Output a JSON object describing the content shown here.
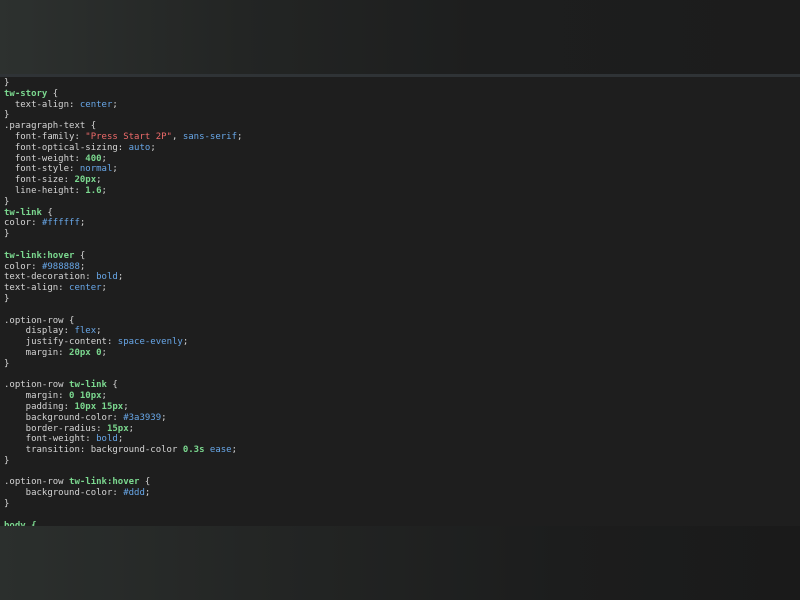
{
  "editor": {
    "lines": [
      [
        {
          "t": "}",
          "c": "punc"
        }
      ],
      [
        {
          "t": "tw-story",
          "c": "sel"
        },
        {
          "t": " {",
          "c": "punc"
        }
      ],
      [
        {
          "t": "  text-align: ",
          "c": "prop"
        },
        {
          "t": "center",
          "c": "val"
        },
        {
          "t": ";",
          "c": "punc"
        }
      ],
      [
        {
          "t": "}",
          "c": "punc"
        }
      ],
      [
        {
          "t": ".paragraph-text",
          "c": "prop"
        },
        {
          "t": " {",
          "c": "punc"
        }
      ],
      [
        {
          "t": "  font-family: ",
          "c": "prop"
        },
        {
          "t": "\"Press Start 2P\"",
          "c": "str"
        },
        {
          "t": ", ",
          "c": "punc"
        },
        {
          "t": "sans-serif",
          "c": "val"
        },
        {
          "t": ";",
          "c": "punc"
        }
      ],
      [
        {
          "t": "  font-optical-sizing: ",
          "c": "prop"
        },
        {
          "t": "auto",
          "c": "val"
        },
        {
          "t": ";",
          "c": "punc"
        }
      ],
      [
        {
          "t": "  font-weight: ",
          "c": "prop"
        },
        {
          "t": "400",
          "c": "num"
        },
        {
          "t": ";",
          "c": "punc"
        }
      ],
      [
        {
          "t": "  font-style: ",
          "c": "prop"
        },
        {
          "t": "normal",
          "c": "val"
        },
        {
          "t": ";",
          "c": "punc"
        }
      ],
      [
        {
          "t": "  font-size: ",
          "c": "prop"
        },
        {
          "t": "20px",
          "c": "num"
        },
        {
          "t": ";",
          "c": "punc"
        }
      ],
      [
        {
          "t": "  line-height: ",
          "c": "prop"
        },
        {
          "t": "1.6",
          "c": "num"
        },
        {
          "t": ";",
          "c": "punc"
        }
      ],
      [
        {
          "t": "}",
          "c": "punc"
        }
      ],
      [
        {
          "t": "tw-link",
          "c": "sel"
        },
        {
          "t": " {",
          "c": "punc"
        }
      ],
      [
        {
          "t": "color: ",
          "c": "prop"
        },
        {
          "t": "#ffffff",
          "c": "hex"
        },
        {
          "t": ";",
          "c": "punc"
        }
      ],
      [
        {
          "t": "}",
          "c": "punc"
        }
      ],
      [],
      [
        {
          "t": "tw-link:hover",
          "c": "sel"
        },
        {
          "t": " {",
          "c": "punc"
        }
      ],
      [
        {
          "t": "color: ",
          "c": "prop"
        },
        {
          "t": "#988888",
          "c": "hex"
        },
        {
          "t": ";",
          "c": "punc"
        }
      ],
      [
        {
          "t": "text-decoration: ",
          "c": "prop"
        },
        {
          "t": "bold",
          "c": "val"
        },
        {
          "t": ";",
          "c": "punc"
        }
      ],
      [
        {
          "t": "text-align: ",
          "c": "prop"
        },
        {
          "t": "center",
          "c": "val"
        },
        {
          "t": ";",
          "c": "punc"
        }
      ],
      [
        {
          "t": "}",
          "c": "punc"
        }
      ],
      [],
      [
        {
          "t": ".option-row",
          "c": "prop"
        },
        {
          "t": " {",
          "c": "punc"
        }
      ],
      [
        {
          "t": "    display: ",
          "c": "prop"
        },
        {
          "t": "flex",
          "c": "val"
        },
        {
          "t": ";",
          "c": "punc"
        }
      ],
      [
        {
          "t": "    justify-content: ",
          "c": "prop"
        },
        {
          "t": "space-evenly",
          "c": "val"
        },
        {
          "t": ";",
          "c": "punc"
        }
      ],
      [
        {
          "t": "    margin: ",
          "c": "prop"
        },
        {
          "t": "20px 0",
          "c": "num"
        },
        {
          "t": ";",
          "c": "punc"
        }
      ],
      [
        {
          "t": "}",
          "c": "punc"
        }
      ],
      [],
      [
        {
          "t": ".option-row ",
          "c": "prop"
        },
        {
          "t": "tw-link",
          "c": "sel"
        },
        {
          "t": " {",
          "c": "punc"
        }
      ],
      [
        {
          "t": "    margin: ",
          "c": "prop"
        },
        {
          "t": "0 10px",
          "c": "num"
        },
        {
          "t": ";",
          "c": "punc"
        }
      ],
      [
        {
          "t": "    padding: ",
          "c": "prop"
        },
        {
          "t": "10px 15px",
          "c": "num"
        },
        {
          "t": ";",
          "c": "punc"
        }
      ],
      [
        {
          "t": "    background-color: ",
          "c": "prop"
        },
        {
          "t": "#3a3939",
          "c": "hex"
        },
        {
          "t": ";",
          "c": "punc"
        }
      ],
      [
        {
          "t": "    border-radius: ",
          "c": "prop"
        },
        {
          "t": "15px",
          "c": "num"
        },
        {
          "t": ";",
          "c": "punc"
        }
      ],
      [
        {
          "t": "    font-weight: ",
          "c": "prop"
        },
        {
          "t": "bold",
          "c": "val"
        },
        {
          "t": ";",
          "c": "punc"
        }
      ],
      [
        {
          "t": "    transition: background-color ",
          "c": "prop"
        },
        {
          "t": "0.3s",
          "c": "num"
        },
        {
          "t": " ",
          "c": "punc"
        },
        {
          "t": "ease",
          "c": "val"
        },
        {
          "t": ";",
          "c": "punc"
        }
      ],
      [
        {
          "t": "}",
          "c": "punc"
        }
      ],
      [],
      [
        {
          "t": ".option-row ",
          "c": "prop"
        },
        {
          "t": "tw-link:hover",
          "c": "sel"
        },
        {
          "t": " {",
          "c": "punc"
        }
      ],
      [
        {
          "t": "    background-color: ",
          "c": "prop"
        },
        {
          "t": "#ddd",
          "c": "hex"
        },
        {
          "t": ";",
          "c": "punc"
        }
      ],
      [
        {
          "t": "}",
          "c": "punc"
        }
      ],
      [],
      [
        {
          "t": "body {",
          "c": "sel"
        }
      ]
    ]
  }
}
